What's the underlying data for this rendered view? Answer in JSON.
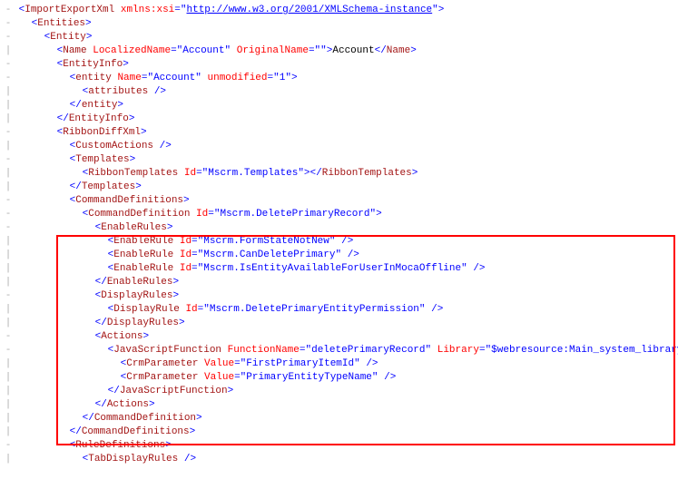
{
  "fold": "-",
  "bar": "|",
  "lt": "<",
  "gt": ">",
  "ltc": "</",
  "sgt": " />",
  "q": "\"",
  "eq": "=",
  "sp": " ",
  "schemaUrl": "http://www.w3.org/2001/XMLSchema-instance",
  "tags": {
    "importExportXml": "ImportExportXml",
    "entities": "Entities",
    "entity": "Entity",
    "name": "Name",
    "entityInfo": "EntityInfo",
    "entityLc": "entity",
    "attributes": "attributes",
    "ribbonDiffXml": "RibbonDiffXml",
    "customActions": "CustomActions",
    "templates": "Templates",
    "ribbonTemplates": "RibbonTemplates",
    "commandDefinitions": "CommandDefinitions",
    "commandDefinition": "CommandDefinition",
    "enableRules": "EnableRules",
    "enableRule": "EnableRule",
    "displayRules": "DisplayRules",
    "displayRule": "DisplayRule",
    "actions": "Actions",
    "javaScriptFunction": "JavaScriptFunction",
    "crmParameter": "CrmParameter",
    "ruleDefinitions": "RuleDefinitions",
    "tabDisplayRules": "TabDisplayRules"
  },
  "attrs": {
    "xmlnsXsi": "xmlns:xsi",
    "localizedName": "LocalizedName",
    "originalName": "OriginalName",
    "nameAttr": "Name",
    "unmodified": "unmodified",
    "id": "Id",
    "functionName": "FunctionName",
    "library": "Library",
    "value": "Value"
  },
  "vals": {
    "account": "Account",
    "empty": "",
    "one": "1",
    "mscrmTemplates": "Mscrm.Templates",
    "deletePrimaryRecord": "Mscrm.DeletePrimaryRecord",
    "formStateNotNew": "Mscrm.FormStateNotNew",
    "canDeletePrimary": "Mscrm.CanDeletePrimary",
    "isEntityAvailable": "Mscrm.IsEntityAvailableForUserInMocaOffline",
    "deletePrimaryEntityPerm": "Mscrm.DeletePrimaryEntityPermission",
    "jsFunc": "deletePrimaryRecord",
    "jsLib": "$webresource:Main_system_library.js",
    "firstPrimaryItemId": "FirstPrimaryItemId",
    "primaryEntityTypeName": "PrimaryEntityTypeName"
  },
  "text": {
    "accountText": "Account"
  }
}
